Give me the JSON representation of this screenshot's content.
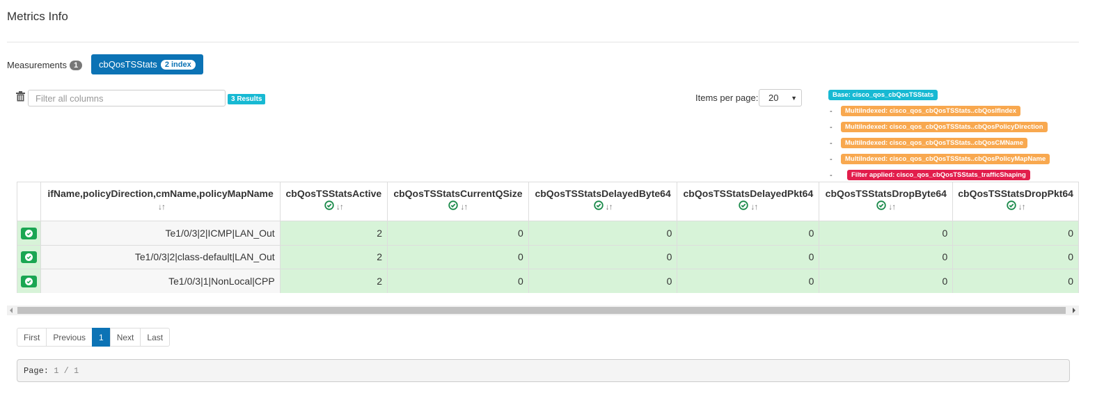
{
  "page": {
    "title": "Metrics Info"
  },
  "measurements": {
    "label": "Measurements",
    "count": "1",
    "tabs": [
      {
        "label": "cbQosTSStats",
        "badge": "2 index",
        "active": true
      }
    ]
  },
  "filter": {
    "placeholder": "Filter all columns",
    "value": "",
    "results_badge": "3 Results",
    "clear_icon": "trash-icon"
  },
  "items_per_page": {
    "label": "Items per page:",
    "selected": "20"
  },
  "labels": {
    "base": "Base: cisco_qos_cbQosTSStats",
    "multi_indexed": [
      "MultiIndexed: cisco_qos_cbQosTSStats..cbQosIfIndex",
      "MultiIndexed: cisco_qos_cbQosTSStats..cbQosPolicyDirection",
      "MultiIndexed: cisco_qos_cbQosTSStats..cbQosCMName",
      "MultiIndexed: cisco_qos_cbQosTSStats..cbQosPolicyMapName"
    ],
    "filter_applied": "Filter applied: cisco_qos_cbQosTSStats_trafficShaping",
    "dash": "-"
  },
  "table": {
    "sort_glyph": "↓↑",
    "columns": [
      {
        "label": "ifName,policyDirection,cmName,policyMapName",
        "selectable": false
      },
      {
        "label": "cbQosTSStatsActive",
        "selectable": true
      },
      {
        "label": "cbQosTSStatsCurrentQSize",
        "selectable": true
      },
      {
        "label": "cbQosTSStatsDelayedByte64",
        "selectable": true
      },
      {
        "label": "cbQosTSStatsDelayedPkt64",
        "selectable": true
      },
      {
        "label": "cbQosTSStatsDropByte64",
        "selectable": true
      },
      {
        "label": "cbQosTSStatsDropPkt64",
        "selectable": true
      }
    ],
    "rows": [
      {
        "index": "Te1/0/3|2|ICMP|LAN_Out",
        "values": [
          "2",
          "0",
          "0",
          "0",
          "0",
          "0"
        ]
      },
      {
        "index": "Te1/0/3|2|class-default|LAN_Out",
        "values": [
          "2",
          "0",
          "0",
          "0",
          "0",
          "0"
        ]
      },
      {
        "index": "Te1/0/3|1|NonLocal|CPP",
        "values": [
          "2",
          "0",
          "0",
          "0",
          "0",
          "0"
        ]
      }
    ]
  },
  "pagination": {
    "first": "First",
    "previous": "Previous",
    "current": "1",
    "next": "Next",
    "last": "Last"
  },
  "page_info": {
    "label": "Page:",
    "current": "1",
    "separator": "/",
    "total": "1"
  },
  "colors": {
    "primary": "#0c73b5",
    "info": "#17b9d3",
    "warning": "#f8a84f",
    "danger": "#e21e4c",
    "success": "#1aa652",
    "row_highlight": "#d7f3d8"
  }
}
